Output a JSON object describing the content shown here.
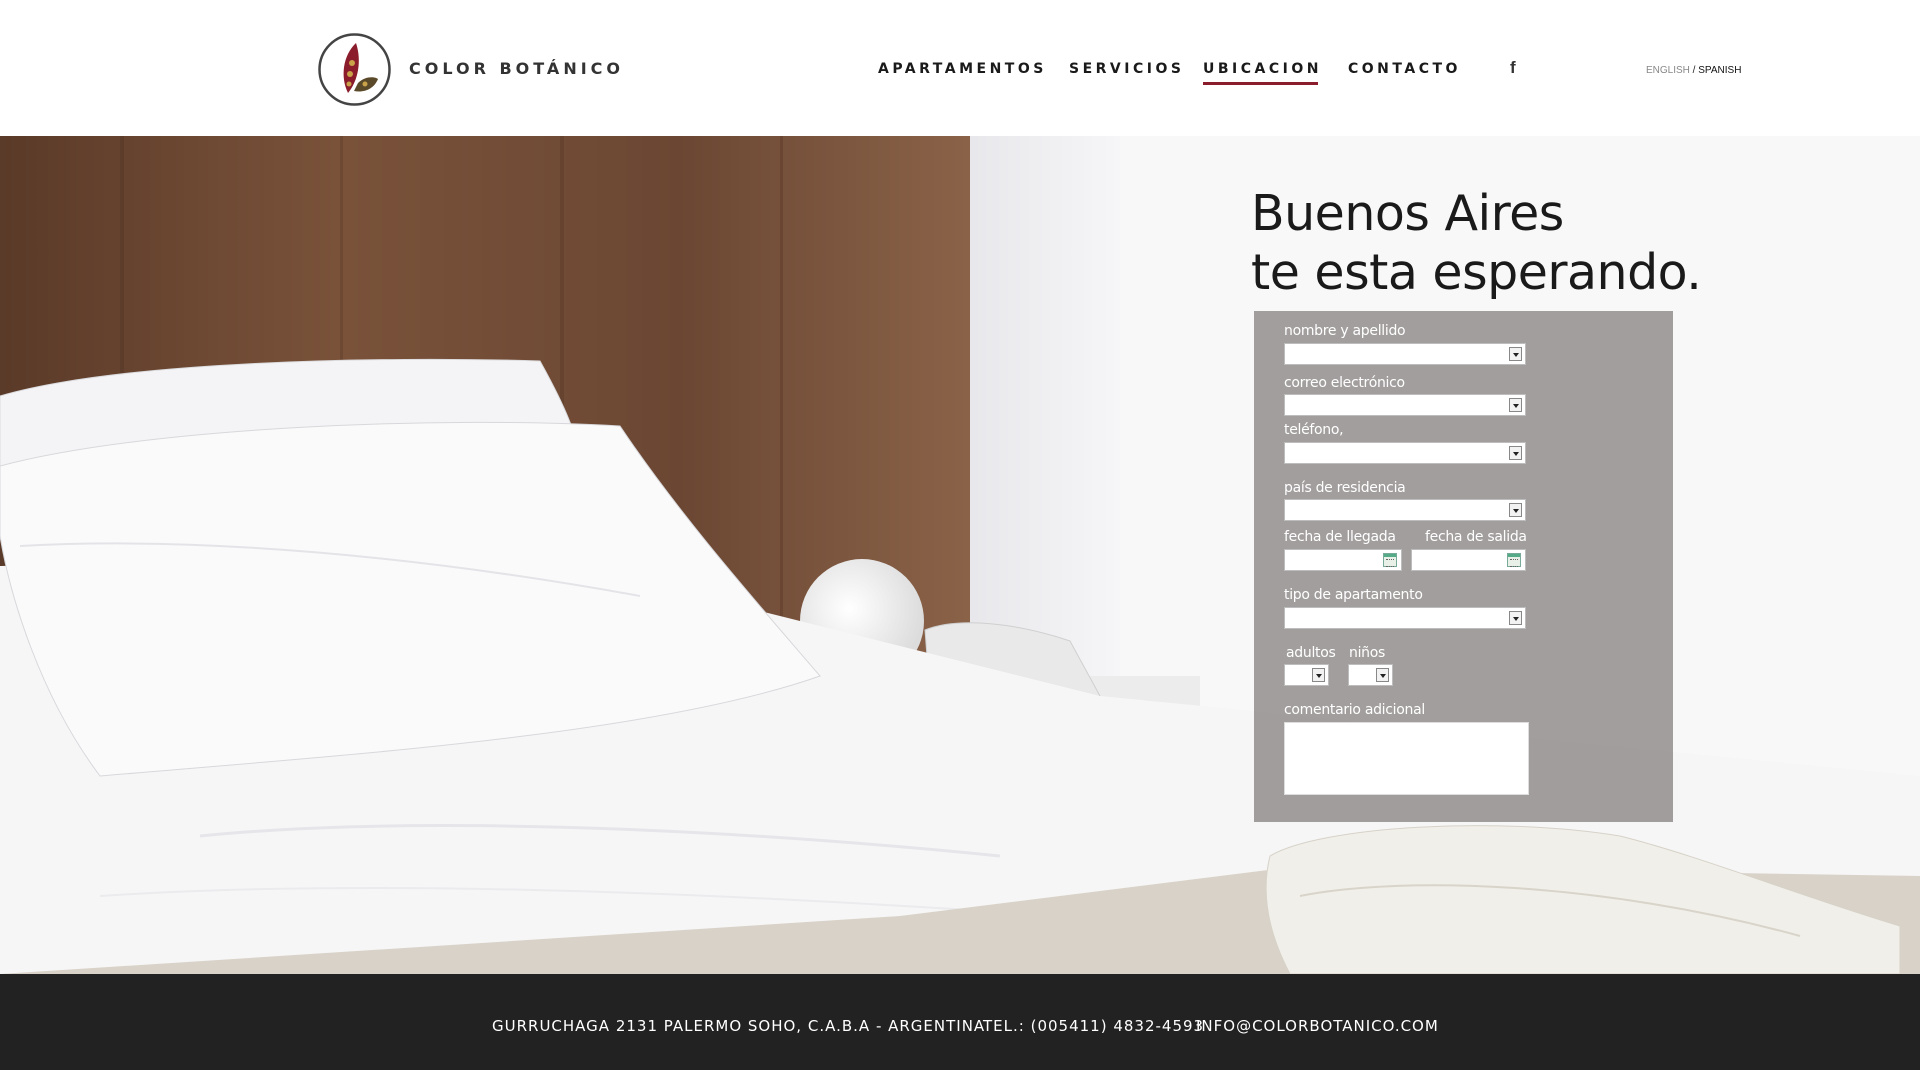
{
  "brand": {
    "name": "COLOR BOTÁNICO"
  },
  "nav": {
    "items": [
      {
        "label": "APARTAMENTOS",
        "active": false
      },
      {
        "label": "SERVICIOS",
        "active": false
      },
      {
        "label": "UBICACION",
        "active": true
      },
      {
        "label": "CONTACTO",
        "active": false
      }
    ],
    "social_icon": "facebook-icon",
    "social_glyph": "f"
  },
  "language": {
    "english": "ENGLISH",
    "separator": " / ",
    "spanish": "SPANISH"
  },
  "hero": {
    "line1": "Buenos Aires",
    "line2": "te esta esperando."
  },
  "form": {
    "name_label": "nombre y apellido",
    "email_label": "correo electrónico",
    "phone_label": "teléfono,",
    "country_label": "país de residencia",
    "arrival_label": "fecha de llegada",
    "departure_label": "fecha de salida",
    "apartment_type_label": "tipo de apartamento",
    "adults_label": "adultos",
    "children_label": "niños",
    "comment_label": "comentario adicional"
  },
  "footer": {
    "address": "GURRUCHAGA 2131  PALERMO SOHO, C.A.B.A  - ARGENTINA",
    "phone": "TEL.: (005411) 4832-4593",
    "email": "INFO@COLORBOTANICO.COM"
  },
  "colors": {
    "accent": "#8b1c2b",
    "footer_bg": "#222222",
    "form_bg": "#969191",
    "wood": "#6e4a34"
  }
}
